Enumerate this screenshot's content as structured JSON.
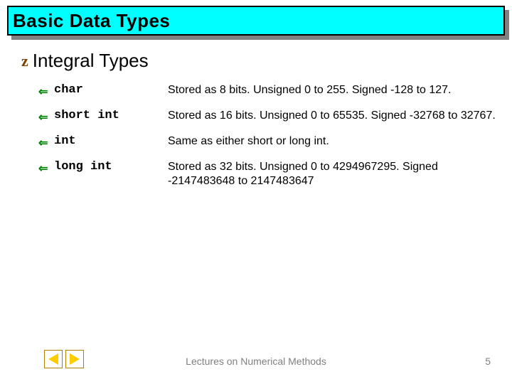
{
  "title": "Basic Data Types",
  "section": {
    "bullet": "z",
    "heading": "Integral Types"
  },
  "types": [
    {
      "name": "char",
      "desc": "Stored as 8 bits. Unsigned 0 to 255. Signed  -128 to 127."
    },
    {
      "name": "short int",
      "desc": "Stored as 16 bits. Unsigned 0 to 65535. Signed -32768 to 32767."
    },
    {
      "name": "int",
      "desc": "Same as either short or long int."
    },
    {
      "name": "long int",
      "desc": "Stored as 32 bits. Unsigned 0 to 4294967295. Signed  -2147483648 to  2147483647"
    }
  ],
  "footer": "Lectures on Numerical Methods",
  "page": "5",
  "arrow_glyph": "⇐"
}
